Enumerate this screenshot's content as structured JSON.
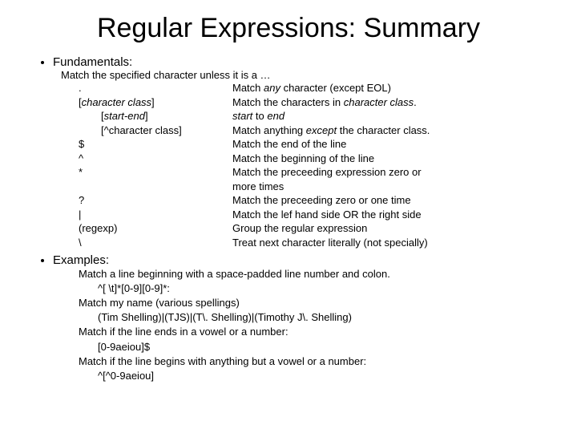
{
  "title": "Regular Expressions: Summary",
  "sections": {
    "fundamentals": {
      "heading": "Fundamentals:",
      "intro": "Match the specified character unless it is a …",
      "rows": [
        {
          "sym_plain": ".",
          "desc_pre": "Match ",
          "desc_em": "any",
          "desc_post": " character (except EOL)",
          "indent": false
        },
        {
          "sym_pre": "[",
          "sym_em": "character class",
          "sym_post": "]",
          "desc_pre": "Match the characters in ",
          "desc_em": "character class",
          "desc_post": ".",
          "indent": false
        },
        {
          "sym_pre": "[",
          "sym_em": "start-end",
          "sym_post": "]",
          "desc_em_lead": "start",
          "desc_mid": " to ",
          "desc_em_trail": "end",
          "indent": true
        },
        {
          "sym_plain": "[^character class]",
          "desc_pre": "Match anything ",
          "desc_em": "except",
          "desc_post": " the character class.",
          "indent": true
        },
        {
          "sym_plain": "$",
          "desc_plain": "Match the end of the line",
          "indent": false
        },
        {
          "sym_plain": "^",
          "desc_plain": "Match the beginning of the line",
          "indent": false
        },
        {
          "sym_plain": "*",
          "desc_plain": "Match the preceeding expression zero or",
          "indent": false
        },
        {
          "sym_plain": "",
          "desc_plain": "more times",
          "indent": false
        },
        {
          "sym_plain": "?",
          "desc_plain": "Match the preceeding zero or one time",
          "indent": false
        },
        {
          "sym_plain": "|",
          "desc_plain": "Match the lef hand side OR the right side",
          "indent": false
        },
        {
          "sym_plain": "(regexp)",
          "desc_plain": "Group the regular expression",
          "indent": false
        },
        {
          "sym_plain": "\\",
          "desc_plain": "Treat next character literally (not specially)",
          "indent": false
        }
      ]
    },
    "examples": {
      "heading": "Examples:",
      "items": [
        {
          "desc": "Match a line beginning with a space-padded line number and colon.",
          "code": "^[ \\t]*[0-9][0-9]*:"
        },
        {
          "desc": "Match my name (various spellings)",
          "code": "(Tim Shelling)|(TJS)|(T\\. Shelling)|(Timothy J\\. Shelling)"
        },
        {
          "desc": "Match if the line ends in a vowel or a number:",
          "code": "[0-9aeiou]$"
        },
        {
          "desc": "Match if the line begins with anything but a vowel or a number:",
          "code": "^[^0-9aeiou]"
        }
      ]
    }
  }
}
